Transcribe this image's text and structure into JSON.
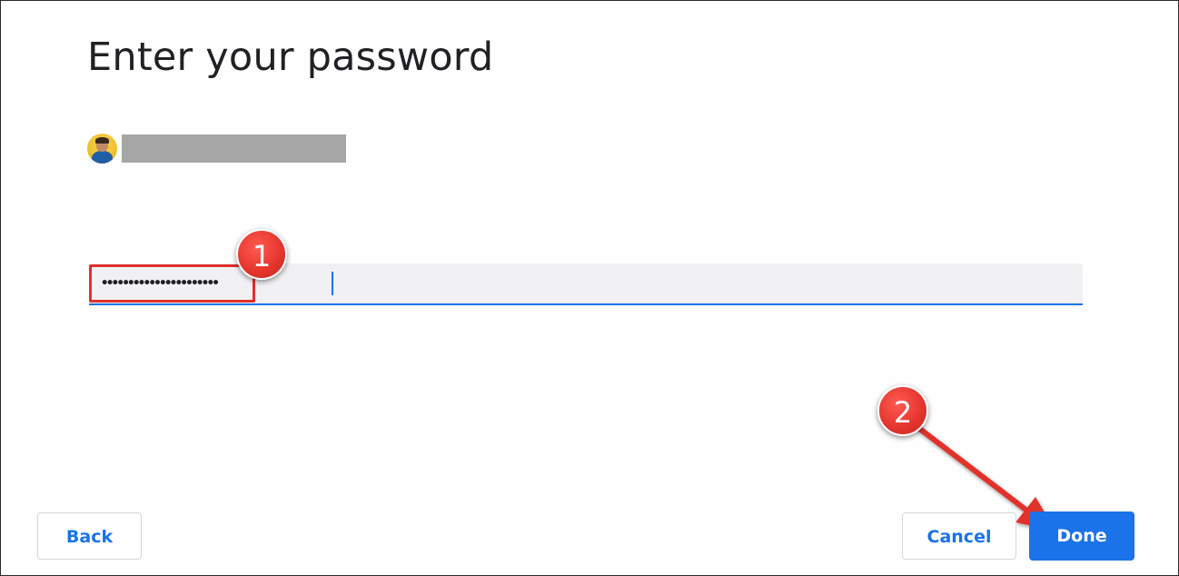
{
  "dialog": {
    "title": "Enter your password"
  },
  "account": {
    "avatar_icon": "user-avatar",
    "name_redacted": true
  },
  "password_field": {
    "value": "••••••••••••••••••••••",
    "masked": true,
    "focused": true
  },
  "annotations": {
    "step1": "1",
    "step2": "2",
    "highlight_color": "#e0302b",
    "arrow_color": "#e0302b"
  },
  "buttons": {
    "back": "Back",
    "cancel": "Cancel",
    "done": "Done"
  },
  "colors": {
    "accent": "#1a73e8",
    "field_bg": "#f1f1f3"
  }
}
